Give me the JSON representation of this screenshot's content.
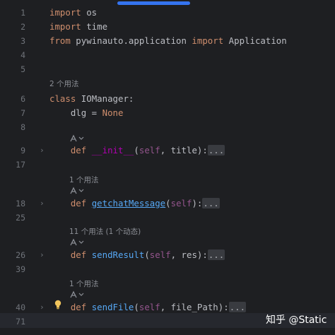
{
  "editor": {
    "lines": [
      {
        "num": "1",
        "code": [
          {
            "t": "import",
            "c": "kw"
          },
          {
            "t": " os",
            "c": ""
          }
        ]
      },
      {
        "num": "2",
        "code": [
          {
            "t": "import",
            "c": "kw"
          },
          {
            "t": " time",
            "c": ""
          }
        ]
      },
      {
        "num": "3",
        "code": [
          {
            "t": "from",
            "c": "kw"
          },
          {
            "t": " pywinauto.application ",
            "c": ""
          },
          {
            "t": "import",
            "c": "kw"
          },
          {
            "t": " Application",
            "c": ""
          }
        ]
      },
      {
        "num": "4",
        "code": []
      },
      {
        "num": "5",
        "code": []
      },
      {
        "num": "6",
        "code": [
          {
            "t": "class",
            "c": "kw"
          },
          {
            "t": " IOManager:",
            "c": ""
          }
        ]
      },
      {
        "num": "7",
        "code": [
          {
            "t": "    dlg = ",
            "c": ""
          },
          {
            "t": "None",
            "c": "kw"
          }
        ]
      },
      {
        "num": "8",
        "code": []
      },
      {
        "num": "9",
        "code": [
          {
            "t": "    ",
            "c": ""
          },
          {
            "t": "def",
            "c": "kw"
          },
          {
            "t": " ",
            "c": ""
          },
          {
            "t": "__init__",
            "c": "dunder"
          },
          {
            "t": "(",
            "c": ""
          },
          {
            "t": "self",
            "c": "self"
          },
          {
            "t": ", title):",
            "c": ""
          },
          {
            "t": "...",
            "c": "fold-box"
          }
        ]
      },
      {
        "num": "17",
        "code": []
      },
      {
        "num": "18",
        "code": [
          {
            "t": "    ",
            "c": ""
          },
          {
            "t": "def",
            "c": "kw"
          },
          {
            "t": " ",
            "c": ""
          },
          {
            "t": "getchatMessage",
            "c": "underline-fn"
          },
          {
            "t": "(",
            "c": ""
          },
          {
            "t": "self",
            "c": "self"
          },
          {
            "t": "):",
            "c": ""
          },
          {
            "t": "...",
            "c": "fold-box"
          }
        ]
      },
      {
        "num": "25",
        "code": []
      },
      {
        "num": "26",
        "code": [
          {
            "t": "    ",
            "c": ""
          },
          {
            "t": "def",
            "c": "kw"
          },
          {
            "t": " ",
            "c": ""
          },
          {
            "t": "sendResult",
            "c": "fn"
          },
          {
            "t": "(",
            "c": ""
          },
          {
            "t": "self",
            "c": "self"
          },
          {
            "t": ", res):",
            "c": ""
          },
          {
            "t": "...",
            "c": "fold-box"
          }
        ]
      },
      {
        "num": "39",
        "code": []
      },
      {
        "num": "40",
        "code": [
          {
            "t": "    ",
            "c": ""
          },
          {
            "t": "def",
            "c": "kw"
          },
          {
            "t": " ",
            "c": ""
          },
          {
            "t": "sendFile",
            "c": "fn"
          },
          {
            "t": "(",
            "c": ""
          },
          {
            "t": "self",
            "c": "self"
          },
          {
            "t": ", file_Path):",
            "c": ""
          },
          {
            "t": "...",
            "c": "fold-box"
          }
        ]
      },
      {
        "num": "71",
        "code": []
      }
    ],
    "hints": {
      "class_usages": "2 个用法",
      "getchat_usages": "1 个用法",
      "sendresult_usages": "11 个用法 (1 个动态)",
      "sendfile_usages": "1 个用法"
    }
  },
  "watermark": "知乎 @Static",
  "colors": {
    "background": "#1e1f22",
    "keyword": "#cf8e6d",
    "function": "#56a8f5",
    "dunder": "#b200b2",
    "self": "#94558d",
    "scrollbar": "#3574f0"
  }
}
